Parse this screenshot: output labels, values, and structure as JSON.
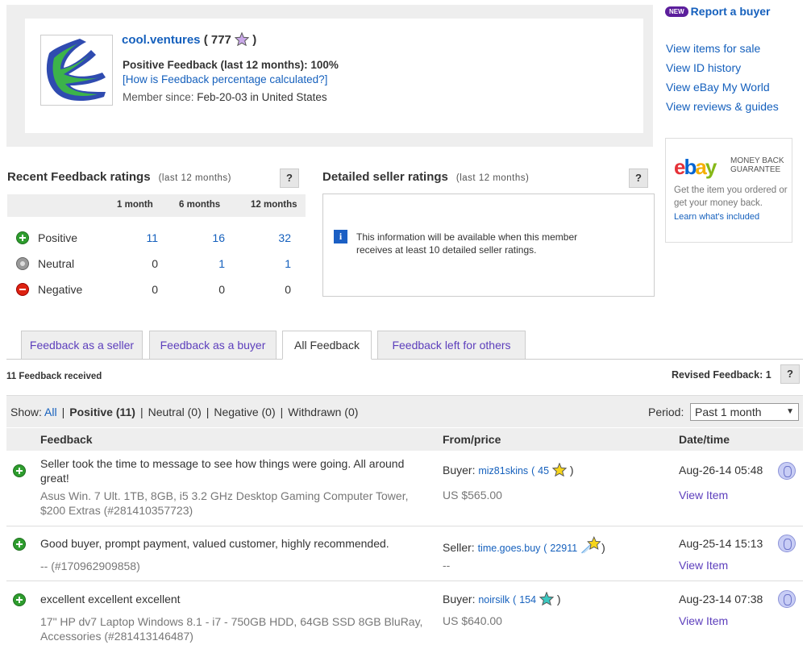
{
  "profile": {
    "username": "cool.ventures",
    "score_open": " ( 777 ",
    "score_close": " )",
    "positive_feedback": "Positive Feedback (last 12 months): 100%",
    "how_link": "[How is Feedback percentage calculated?]",
    "member_since_label": "Member since:",
    "member_since_value": "Feb-20-03 in United States"
  },
  "sidebar": {
    "new_badge": "NEW",
    "report_link": "Report a buyer",
    "links": [
      "View items for sale",
      "View ID history",
      "View eBay My World",
      "View reviews & guides"
    ],
    "mbg_line1": "MONEY BACK",
    "mbg_line2": "GUARANTEE",
    "mbg_desc": "Get the item you ordered or get your money back.",
    "mbg_learn": "Learn what's included"
  },
  "recent": {
    "title": "Recent Feedback ratings",
    "subtitle": "(last 12 months)",
    "help": "?",
    "headers": [
      "1 month",
      "6 months",
      "12 months"
    ],
    "rows": [
      {
        "label": "Positive",
        "values": [
          "11",
          "16",
          "32"
        ]
      },
      {
        "label": "Neutral",
        "values": [
          "0",
          "1",
          "1"
        ]
      },
      {
        "label": "Negative",
        "values": [
          "0",
          "0",
          "0"
        ]
      }
    ]
  },
  "detailed": {
    "title": "Detailed seller ratings",
    "subtitle": "(last 12 months)",
    "help": "?",
    "info_icon": "i",
    "info_text": "This information will be available when this member receives at least 10 detailed seller ratings."
  },
  "tabs": [
    "Feedback as a seller",
    "Feedback as a buyer",
    "All Feedback",
    "Feedback left for others"
  ],
  "summary": {
    "received": "11 Feedback received",
    "revised": "Revised Feedback: 1",
    "help": "?"
  },
  "filter": {
    "show_label": "Show:",
    "all": "All",
    "positive": "Positive (11)",
    "neutral": "Neutral (0)",
    "negative": "Negative (0)",
    "withdrawn": "Withdrawn (0)",
    "period_label": "Period:",
    "period_value": "Past 1 month"
  },
  "table": {
    "headers": [
      "Feedback",
      "From/price",
      "Date/time"
    ],
    "rows": [
      {
        "comment": "Seller took the time to message to see how things were going. All around great!",
        "item": "Asus Win. 7 Ult. 1TB, 8GB, i5 3.2 GHz Desktop Gaming Computer Tower, $200 Extras (#281410357723)",
        "role": "Buyer:",
        "user": "miz81skins",
        "score": "45",
        "star_color": "#f7d51a",
        "price": "US $565.00",
        "date": "Aug-26-14 05:48",
        "view": "View Item"
      },
      {
        "comment": "Good buyer, prompt payment, valued customer, highly recommended.",
        "item": "-- (#170962909858)",
        "role": "Seller:",
        "user": "time.goes.buy",
        "score": "22911",
        "star_color": "#f7d51a",
        "price": "--",
        "date": "Aug-25-14 15:13",
        "view": "View Item"
      },
      {
        "comment": "excellent excellent excellent",
        "item": "17\" HP dv7 Laptop Windows 8.1 - i7 - 750GB HDD, 64GB SSD 8GB BluRay, Accessories (#281413146487)",
        "role": "Buyer:",
        "user": "noirsilk",
        "score": "154",
        "star_color": "#3bc8c0",
        "price": "US $640.00",
        "date": "Aug-23-14 07:38",
        "view": "View Item"
      }
    ]
  }
}
